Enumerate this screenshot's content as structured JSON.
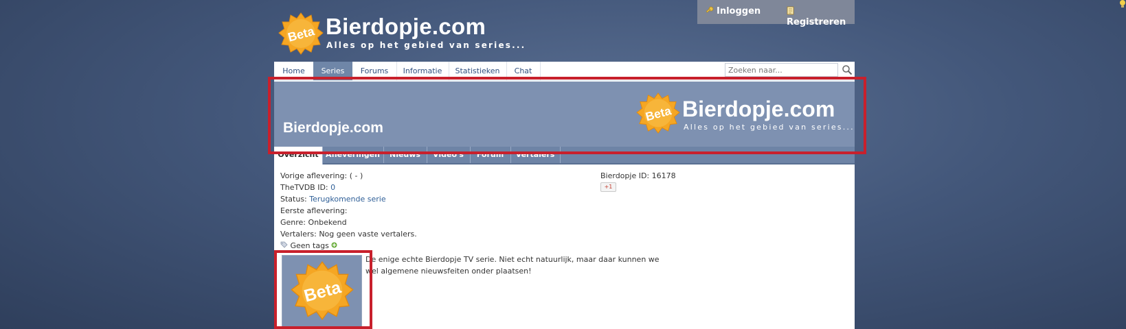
{
  "auth": {
    "login_label": "Inloggen",
    "register_label": "Registreren"
  },
  "logo": {
    "badge": "Beta",
    "title": "Bierdopje.com",
    "subtitle": "Alles op het gebied van series..."
  },
  "nav": {
    "items": [
      "Home",
      "Series",
      "Forums",
      "Informatie",
      "Statistieken",
      "Chat"
    ],
    "active": "Series"
  },
  "search": {
    "placeholder": "Zoeken naar..."
  },
  "banner": {
    "title": "Bierdopje.com",
    "logo_title": "Bierdopje.com",
    "logo_subtitle": "Alles op het gebied van series...",
    "logo_badge": "Beta"
  },
  "subtabs": {
    "items": [
      "Overzicht",
      "Afleveringen",
      "Nieuws",
      "Video's",
      "Forum",
      "Vertalers"
    ],
    "active": "Overzicht"
  },
  "info": {
    "prev_episode_label": "Vorige aflevering:",
    "prev_episode_value": "( - )",
    "tvdb_label": "TheTVDB ID:",
    "tvdb_value": "0",
    "status_label": "Status:",
    "status_value": "Terugkomende serie",
    "first_episode_label": "Eerste aflevering:",
    "genre_label": "Genre:",
    "genre_value": "Onbekend",
    "translators_label": "Vertalers:",
    "translators_value": "Nog geen vaste vertalers.",
    "tags_label": "Geen tags",
    "bierdopje_id_label": "Bierdopje ID:",
    "bierdopje_id_value": "16178",
    "gplus_label": "+1"
  },
  "description": "De enige echte Bierdopje TV serie. Niet echt natuurlijk, maar daar kunnen we wel algemene nieuwsfeiten onder plaatsen!",
  "thumbnail": {
    "badge": "Beta"
  },
  "colors": {
    "accent_red": "#c8202c",
    "banner_blue": "#7e91b1",
    "nav_active": "#6f86a8",
    "badge_orange": "#f5a623"
  }
}
